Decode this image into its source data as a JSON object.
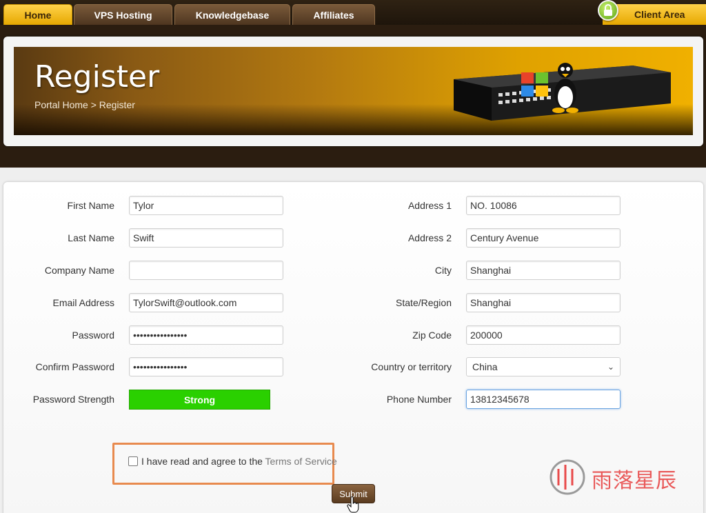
{
  "nav": {
    "tabs": [
      {
        "label": "Home",
        "active": true
      },
      {
        "label": "VPS Hosting",
        "active": false
      },
      {
        "label": "Knowledgebase",
        "active": false
      },
      {
        "label": "Affiliates",
        "active": false
      }
    ],
    "client_area": "Client Area"
  },
  "banner": {
    "title": "Register",
    "breadcrumb": "Portal Home > Register"
  },
  "form": {
    "first_name": {
      "label": "First Name",
      "value": "Tylor"
    },
    "last_name": {
      "label": "Last Name",
      "value": "Swift"
    },
    "company_name": {
      "label": "Company Name",
      "value": ""
    },
    "email": {
      "label": "Email Address",
      "value": "TylorSwift@outlook.com"
    },
    "password": {
      "label": "Password",
      "value": "••••••••••••••••"
    },
    "confirm_password": {
      "label": "Confirm Password",
      "value": "••••••••••••••••"
    },
    "password_strength": {
      "label": "Password Strength",
      "value": "Strong",
      "color": "#2ad000"
    },
    "address1": {
      "label": "Address 1",
      "value": "NO. 10086"
    },
    "address2": {
      "label": "Address 2",
      "value": "Century Avenue"
    },
    "city": {
      "label": "City",
      "value": "Shanghai"
    },
    "state": {
      "label": "State/Region",
      "value": "Shanghai"
    },
    "zip": {
      "label": "Zip Code",
      "value": "200000"
    },
    "country": {
      "label": "Country or territory",
      "value": "China"
    },
    "phone": {
      "label": "Phone Number",
      "value": "13812345678"
    },
    "tos": {
      "text": "I have read and agree to the ",
      "link": "Terms of Service",
      "checked": false
    },
    "submit_label": "Submit"
  },
  "watermark": {
    "text": "雨落星辰"
  },
  "colors": {
    "accent": "#e6a800",
    "highlight_border": "#e88a4e",
    "submit": "#6b4a2b"
  }
}
